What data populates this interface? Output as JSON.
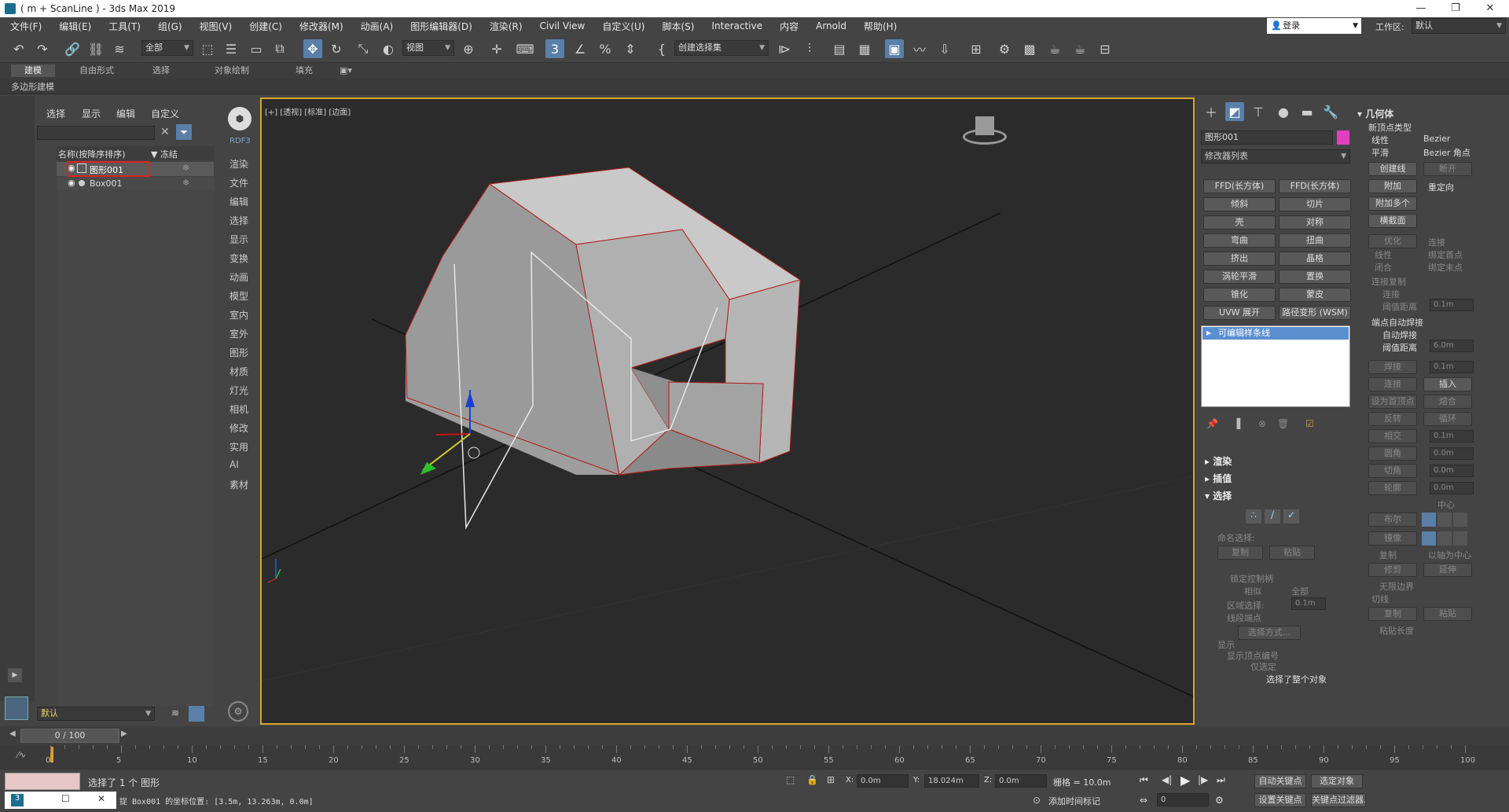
{
  "window": {
    "title": "( m + ScanLine ) - 3ds Max 2019",
    "controls": [
      "—",
      "❐",
      "✕"
    ]
  },
  "menubar": [
    "文件(F)",
    "编辑(E)",
    "工具(T)",
    "组(G)",
    "视图(V)",
    "创建(C)",
    "修改器(M)",
    "动画(A)",
    "图形编辑器(D)",
    "渲染(R)",
    "Civil View",
    "自定义(U)",
    "脚本(S)",
    "Interactive",
    "内容",
    "Arnold",
    "帮助(H)"
  ],
  "account": {
    "login": "登录",
    "workspace_label": "工作区:",
    "workspace_value": "默认"
  },
  "toolbar": {
    "filter_value": "全部",
    "refcoord_value": "视图",
    "selset_value": "创建选择集"
  },
  "ribbon": {
    "tabs": [
      "建模",
      "自由形式",
      "选择",
      "对象绘制",
      "填充"
    ],
    "sub": "多边形建模"
  },
  "explorer": {
    "tabs": [
      "选择",
      "显示",
      "编辑",
      "自定义"
    ],
    "col_name": "名称(按降序排序)",
    "col_freeze": "▼ 冻结",
    "items": [
      {
        "name": "图形001",
        "selected": true
      },
      {
        "name": "Box001",
        "selected": false
      }
    ],
    "layer_value": "默认"
  },
  "cmdlabels": [
    "RDF3",
    "渲染",
    "文件",
    "编辑",
    "选择",
    "显示",
    "变换",
    "动画",
    "模型",
    "室内",
    "室外",
    "图形",
    "材质",
    "灯光",
    "相机",
    "修改",
    "实用",
    "AI",
    "素材"
  ],
  "viewport": {
    "label": "[+] [透视] [标准] [边面]"
  },
  "modify": {
    "object_name": "图形001",
    "object_color": "#e040c0",
    "modifier_list": "修改器列表",
    "buttons": [
      "FFD(长方体)",
      "FFD(长方体)",
      "倾斜",
      "切片",
      "壳",
      "对称",
      "弯曲",
      "扭曲",
      "挤出",
      "晶格",
      "涡轮平滑",
      "置换",
      "锥化",
      "蒙皮",
      "UVW 展开",
      "路径变形 (WSM)"
    ],
    "stack_item": "可编辑样条线",
    "rollouts": [
      "渲染",
      "插值",
      "选择"
    ],
    "named_sel": "命名选择:",
    "copy": "复制",
    "paste": "粘贴",
    "lock_handles": "锁定控制柄",
    "alike": "相似",
    "all": "全部",
    "area_select": "区域选择:",
    "area_value": "0.1m",
    "segment_end": "线段端点",
    "select_by": "选择方式...",
    "display": "显示",
    "show_vert_num": "显示顶点编号",
    "only_selected": "仅选定",
    "status": "选择了整个对象"
  },
  "geometry": {
    "title": "几何体",
    "new_vertex_type": "新顶点类型",
    "linear": "线性",
    "bezier": "Bezier",
    "smooth": "平滑",
    "bezier_corner": "Bezier 角点",
    "create_line": "创建线",
    "break": "断开",
    "attach": "附加",
    "reorient": "重定向",
    "attach_mult": "附加多个",
    "cross_section": "横截面",
    "refine": "优化",
    "connect": "连接",
    "linear2": "线性",
    "bind_first": "绑定首点",
    "closed": "闭合",
    "bind_last": "绑定末点",
    "connect_copy": "连接复制",
    "connect2": "连接",
    "threshold": "阈值距离",
    "threshold_value": "0.1m",
    "end_auto_weld": "端点自动焊接",
    "auto_weld": "自动焊接",
    "threshold2": "阈值距离",
    "threshold2_value": "6.0m",
    "weld": "焊接",
    "weld_value": "0.1m",
    "connect3": "连接",
    "insert": "插入",
    "make_first": "设为首顶点",
    "fuse": "熔合",
    "reverse": "反转",
    "cycle": "循环",
    "intersect": "相交",
    "intersect_value": "0.1m",
    "fillet": "圆角",
    "fillet_value": "0.0m",
    "chamfer": "切角",
    "chamfer_value": "0.0m",
    "outline": "轮廓",
    "outline_value": "0.0m",
    "center": "中心",
    "boolean": "布尔",
    "mirror": "镜像",
    "copy": "复制",
    "about_pivot": "以轴为中心",
    "trim": "修剪",
    "extend": "延伸",
    "infinite": "无限边界",
    "tangent": "切线",
    "copy2": "复制",
    "paste2": "粘贴",
    "paste_length": "粘贴长度"
  },
  "timeline": {
    "slider": "0 / 100",
    "ticks": [
      "0",
      "5",
      "10",
      "15",
      "20",
      "25",
      "30",
      "35",
      "40",
      "45",
      "50",
      "55",
      "60",
      "65",
      "70",
      "75",
      "80",
      "85",
      "90",
      "95",
      "100"
    ]
  },
  "statusbar": {
    "selected": "选择了 1 个 图形",
    "message": "捉 Box001 的坐标位置: [3.5m, 13.263m, 0.0m]",
    "x_label": "X:",
    "x_value": "0.0m",
    "y_label": "Y:",
    "y_value": "18.024m",
    "z_label": "Z:",
    "z_value": "0.0m",
    "grid": "栅格 = 10.0m",
    "add_time_tag": "添加时间标记",
    "frame": "0",
    "auto_key": "自动关键点",
    "set_key": "设置关键点",
    "key_filter": "关键点过滤器...",
    "selected_obj": "选定对象"
  }
}
